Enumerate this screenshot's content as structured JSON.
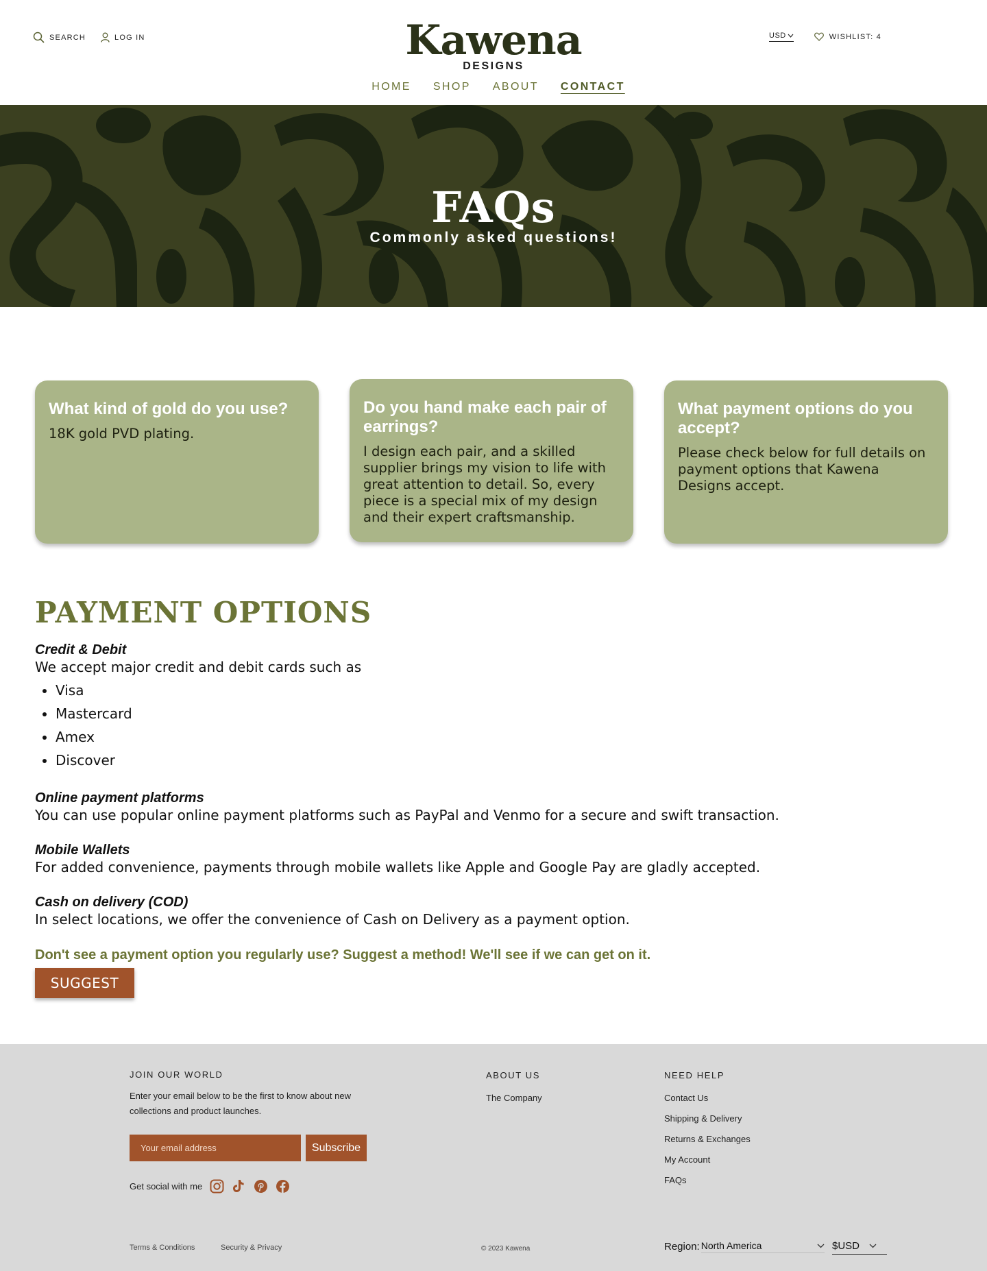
{
  "header": {
    "search_label": "SEARCH",
    "login_label": "LOG IN",
    "logo_main": "Kawena",
    "logo_sub": "DESIGNS",
    "currency": "USD",
    "wishlist_label": "WISHLIST: 4",
    "nav": [
      {
        "label": "HOME",
        "active": false
      },
      {
        "label": "SHOP",
        "active": false
      },
      {
        "label": "ABOUT",
        "active": false
      },
      {
        "label": "CONTACT",
        "active": true
      }
    ]
  },
  "hero": {
    "title": "FAQs",
    "subtitle": "Commonly asked questions!"
  },
  "faq_cards": [
    {
      "question": "What kind of gold do you use?",
      "answer": "18K gold PVD plating."
    },
    {
      "question": "Do you hand make each pair of earrings?",
      "answer": "I design each pair, and a skilled supplier brings my vision to life with great attention to detail. So, every piece is a special mix of my design and their expert craftsmanship."
    },
    {
      "question": "What payment options do you accept?",
      "answer": "Please check below for full details on payment options that Kawena Designs accept."
    }
  ],
  "payment": {
    "title": "PAYMENT OPTIONS",
    "credit_head": "Credit & Debit",
    "credit_text": "We accept major credit and debit cards such as",
    "cards": [
      "Visa",
      "Mastercard",
      "Amex",
      "Discover"
    ],
    "online_head": "Online payment platforms",
    "online_text": "You can use popular online payment platforms such as PayPal and Venmo for a secure and swift transaction.",
    "mobile_head": "Mobile Wallets",
    "mobile_text": "For added convenience, payments through mobile wallets like Apple and Google Pay are gladly accepted.",
    "cod_head": "Cash on delivery (COD)",
    "cod_text": "In select locations, we offer the convenience of Cash on Delivery as a payment option.",
    "suggest_text": "Don't see a payment option you regularly use? Suggest a method! We'll see if we can get on it.",
    "suggest_button": "SUGGEST"
  },
  "footer": {
    "join_title": "JOIN OUR WORLD",
    "join_text_1": "Enter your email below to be the first to know about new",
    "join_text_2": "collections and product launches.",
    "email_placeholder": "Your email address",
    "subscribe_label": "Subscribe",
    "social_label": "Get social with me",
    "social_icons": [
      "instagram-icon",
      "tiktok-icon",
      "pinterest-icon",
      "facebook-icon"
    ],
    "about_title": "ABOUT US",
    "about_links": [
      "The Company"
    ],
    "help_title": "NEED HELP",
    "help_links": [
      "Contact Us",
      "Shipping & Delivery",
      "Returns & Exchanges",
      "My Account",
      "FAQs"
    ],
    "terms": "Terms & Conditions",
    "security": "Security & Privacy",
    "copyright": "© 2023 Kawena",
    "region_label": "Region:",
    "region_value": "North America",
    "currency_value": "$USD"
  },
  "colors": {
    "olive": "#6b7436",
    "dark_olive": "#2b3219",
    "card_green": "#aab588",
    "hero_bg": "#3b4020",
    "rust": "#a1532b",
    "footer_bg": "#d9d9d9"
  }
}
